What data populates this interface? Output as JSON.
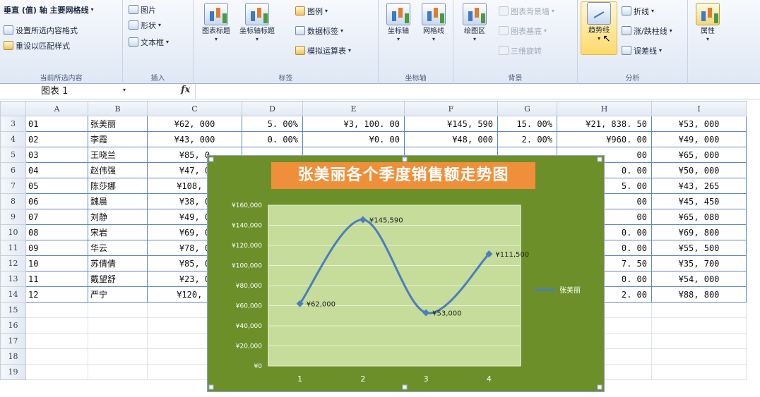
{
  "ribbon": {
    "selection": {
      "dropdown": "垂直 (值) 轴 主要网格线",
      "format_selection": "设置所选内容格式",
      "reset_style": "重设以匹配样式",
      "group_label": "当前所选内容"
    },
    "insert": {
      "picture": "图片",
      "shapes": "形状",
      "textbox": "文本框",
      "group_label": "插入"
    },
    "labels": {
      "chart_title": "图表标题",
      "axis_titles": "坐标轴标题",
      "legend": "图例",
      "data_labels": "数据标签",
      "data_table": "模拟运算表",
      "group_label": "标签"
    },
    "axes": {
      "axes": "坐标轴",
      "gridlines": "网格线",
      "group_label": "坐标轴"
    },
    "background": {
      "plot_area": "绘图区",
      "chart_wall": "图表背景墙",
      "chart_floor": "图表基底",
      "rotation_3d": "三维旋转",
      "group_label": "背景"
    },
    "analysis": {
      "trendline": "趋势线",
      "lines": "折线",
      "updown_bars": "涨/跌柱线",
      "error_bars": "误差线",
      "group_label": "分析"
    },
    "properties": {
      "label": "属性"
    }
  },
  "formula_bar": {
    "name_box": "图表 1",
    "fx": "fx",
    "content": ""
  },
  "sheet": {
    "columns": [
      "A",
      "B",
      "C",
      "D",
      "E",
      "F",
      "G",
      "H",
      "I"
    ],
    "rows": [
      {
        "num": "3",
        "cells": [
          "01",
          "张美丽",
          "¥62, 000",
          "5. 00%",
          "¥3, 100. 00",
          "¥145, 590",
          "15. 00%",
          "¥21, 838. 50",
          "¥53, 000"
        ]
      },
      {
        "num": "4",
        "cells": [
          "02",
          "李霞",
          "¥43, 000",
          "0. 00%",
          "¥0. 00",
          "¥48, 000",
          "2. 00%",
          "¥960. 00",
          "¥49, 000"
        ]
      },
      {
        "num": "5",
        "cells": [
          "03",
          "王晓兰",
          "¥85, 0",
          "",
          "",
          "",
          "",
          "00",
          "¥65, 000"
        ]
      },
      {
        "num": "6",
        "cells": [
          "04",
          "赵伟强",
          "¥47, 0",
          "",
          "",
          "",
          "",
          "0. 00",
          "¥50, 000"
        ]
      },
      {
        "num": "7",
        "cells": [
          "05",
          "陈莎娜",
          "¥108, 0",
          "",
          "",
          "",
          "",
          "5. 00",
          "¥43, 265"
        ]
      },
      {
        "num": "8",
        "cells": [
          "06",
          "魏晨",
          "¥38, 0",
          "",
          "",
          "",
          "",
          "00",
          "¥45, 450"
        ]
      },
      {
        "num": "9",
        "cells": [
          "07",
          "刘静",
          "¥49, 0",
          "",
          "",
          "",
          "",
          "00",
          "¥65, 080"
        ]
      },
      {
        "num": "10",
        "cells": [
          "08",
          "宋岩",
          "¥69, 0",
          "",
          "",
          "",
          "",
          "0. 00",
          "¥69, 800"
        ]
      },
      {
        "num": "11",
        "cells": [
          "09",
          "华云",
          "¥78, 0",
          "",
          "",
          "",
          "",
          "0. 00",
          "¥55, 500"
        ]
      },
      {
        "num": "12",
        "cells": [
          "10",
          "苏倩倩",
          "¥85, 0",
          "",
          "",
          "",
          "",
          "7. 50",
          "¥35, 700"
        ]
      },
      {
        "num": "13",
        "cells": [
          "11",
          "戴望舒",
          "¥23, 0",
          "",
          "",
          "",
          "",
          "0. 00",
          "¥54, 000"
        ]
      },
      {
        "num": "14",
        "cells": [
          "12",
          "严宁",
          "¥120, 0",
          "",
          "",
          "",
          "",
          "2. 00",
          "¥88, 800"
        ]
      },
      {
        "num": "15",
        "cells": [
          "",
          "",
          "",
          "",
          "",
          "",
          "",
          "",
          ""
        ]
      },
      {
        "num": "16",
        "cells": [
          "",
          "",
          "",
          "",
          "",
          "",
          "",
          "",
          ""
        ]
      },
      {
        "num": "17",
        "cells": [
          "",
          "",
          "",
          "",
          "",
          "",
          "",
          "",
          ""
        ]
      },
      {
        "num": "18",
        "cells": [
          "",
          "",
          "",
          "",
          "",
          "",
          "",
          "",
          ""
        ]
      },
      {
        "num": "19",
        "cells": [
          "",
          "",
          "",
          "",
          "",
          "",
          "",
          "",
          ""
        ]
      }
    ]
  },
  "chart_data": {
    "type": "line",
    "title": "张美丽各个季度销售额走势图",
    "categories": [
      "1",
      "2",
      "3",
      "4"
    ],
    "series": [
      {
        "name": "张美丽",
        "values": [
          62000,
          145590,
          53000,
          111500
        ],
        "color": "#4a7ebf"
      }
    ],
    "data_labels": [
      "¥62,000",
      "¥145,590",
      "¥53,000",
      "¥111,500"
    ],
    "y_ticks": [
      "¥0",
      "¥20,000",
      "¥40,000",
      "¥60,000",
      "¥80,000",
      "¥100,000",
      "¥120,000",
      "¥140,000",
      "¥160,000"
    ],
    "ylim": [
      0,
      160000
    ],
    "smooth": true,
    "grid": true,
    "legend_position": "right",
    "chart_bg": "#6c8f2a",
    "plot_bg": "#c5dc9a",
    "title_bg": "#f08f3a"
  }
}
